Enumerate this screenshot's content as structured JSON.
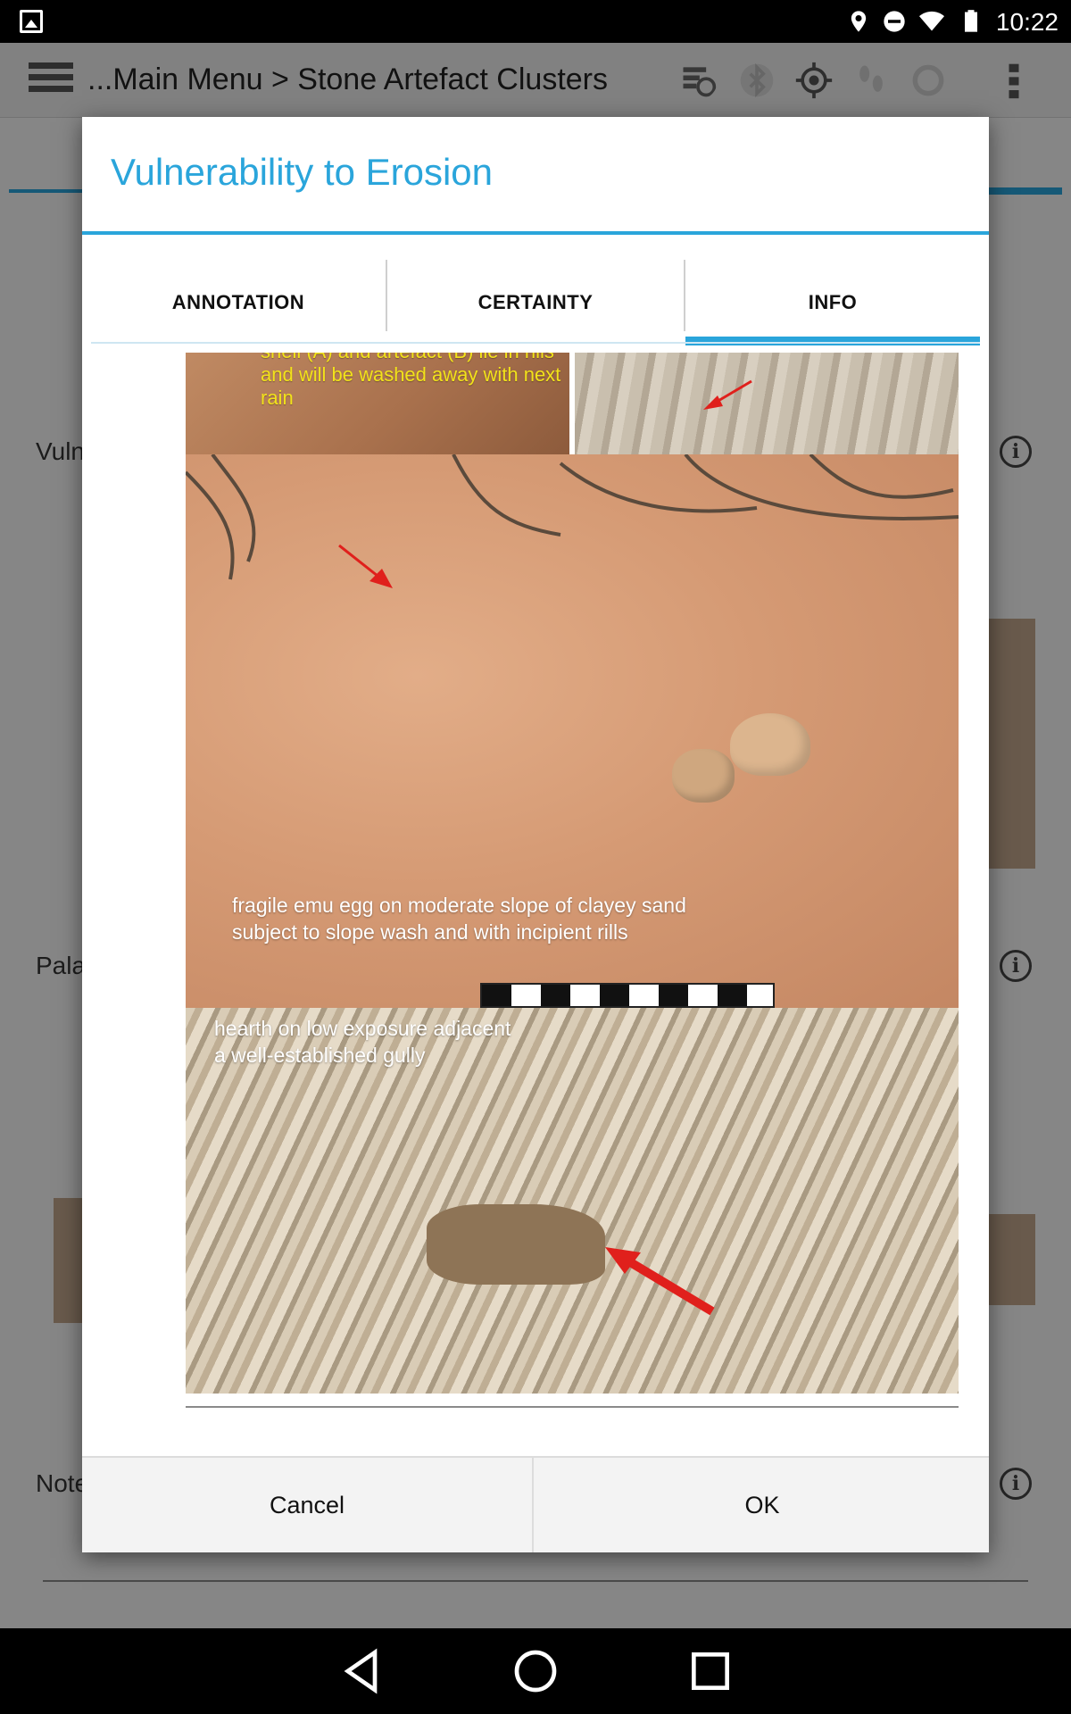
{
  "status_bar": {
    "time": "10:22",
    "icons": [
      "gallery-icon",
      "location-icon",
      "do-not-disturb-icon",
      "wifi-icon",
      "battery-icon"
    ]
  },
  "app": {
    "breadcrumb": "...Main Menu > Stone Artefact Clusters",
    "toolbar_icons": [
      "sync-icon",
      "bluetooth-icon",
      "gps-icon",
      "track-icon",
      "refresh-icon",
      "overflow-menu-icon"
    ],
    "rows": [
      {
        "label": "Vuln"
      },
      {
        "label": "Pala"
      },
      {
        "label": "Note"
      }
    ]
  },
  "dialog": {
    "title": "Vulnerability to Erosion",
    "tabs": [
      {
        "label": "ANNOTATION",
        "selected": false
      },
      {
        "label": "CERTAINTY",
        "selected": false
      },
      {
        "label": "INFO",
        "selected": true
      }
    ],
    "captions": {
      "top": "shell (A) and artefact (B) lie in rills and will be washed away with next rain",
      "middle_line1": "fragile emu egg on moderate slope of clayey sand",
      "middle_line2": "subject to slope wash and with incipient rills",
      "bottom_line1": "hearth on low exposure adjacent",
      "bottom_line2": "a well-established gully"
    },
    "buttons": {
      "cancel": "Cancel",
      "ok": "OK"
    }
  },
  "colors": {
    "accent": "#2aa5db",
    "caption_yellow": "#f2e21a",
    "marker_red": "#e0201c"
  },
  "nav_bar": {
    "icons": [
      "back-icon",
      "home-icon",
      "recents-icon"
    ]
  }
}
